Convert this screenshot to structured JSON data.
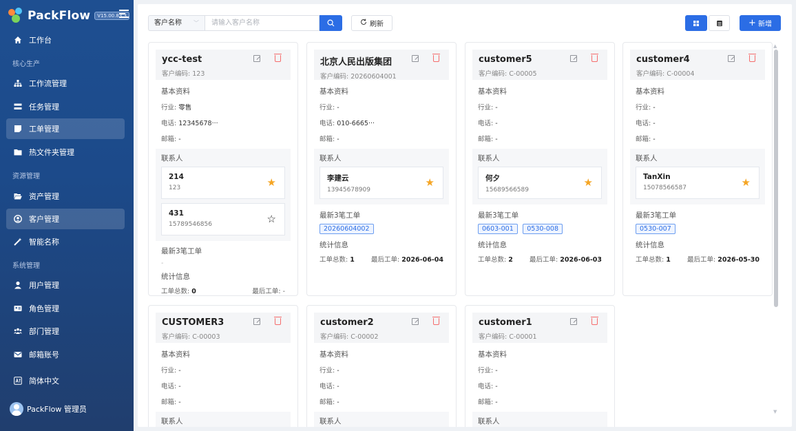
{
  "app": {
    "name": "PackFlow",
    "version": "V15.00.83.3"
  },
  "sidebar": {
    "items": [
      {
        "label": "工作台",
        "icon": "home-icon"
      },
      {
        "label": "工作流管理",
        "icon": "workflow-icon"
      },
      {
        "label": "任务管理",
        "icon": "task-icon"
      },
      {
        "label": "工单管理",
        "icon": "workorder-icon"
      },
      {
        "label": "热文件夹管理",
        "icon": "folder-icon"
      },
      {
        "label": "资产管理",
        "icon": "open-folder-icon"
      },
      {
        "label": "客户管理",
        "icon": "customer-icon"
      },
      {
        "label": "智能名称",
        "icon": "magic-wand-icon"
      },
      {
        "label": "用户管理",
        "icon": "user-icon"
      },
      {
        "label": "角色管理",
        "icon": "id-card-icon"
      },
      {
        "label": "部门管理",
        "icon": "team-icon"
      },
      {
        "label": "邮箱账号",
        "icon": "mail-icon"
      },
      {
        "label": "简体中文",
        "icon": "language-icon"
      }
    ],
    "sections": [
      "核心生产",
      "资源管理",
      "系统管理"
    ],
    "active_items": [
      "工单管理",
      "客户管理"
    ],
    "user": "PackFlow 管理员"
  },
  "toolbar": {
    "filter_field": "客户名称",
    "search_placeholder": "请输入客户名称",
    "refresh_label": "刷新",
    "add_label": "新增"
  },
  "labels": {
    "code_prefix": "客户编码: ",
    "basic": "基本资料",
    "industry": "行业: ",
    "phone": "电话: ",
    "email": "邮箱: ",
    "contacts": "联系人",
    "recent": "最新3笔工单",
    "stats": "统计信息",
    "total": "工单总数: ",
    "last": "最后工单: "
  },
  "customers": [
    {
      "name": "ycc-test",
      "code": "123",
      "industry": "零售",
      "phone": "12345678···",
      "email": "-",
      "contacts": [
        {
          "name": "214",
          "phone": "123",
          "starred": true
        },
        {
          "name": "431",
          "phone": "15789546856",
          "starred": false
        }
      ],
      "recent_orders": [],
      "recent_empty": "-",
      "total": "0",
      "last_order": "-"
    },
    {
      "name": "北京人民出版集团",
      "code": "20260604001",
      "industry": "-",
      "phone": "010-6665···",
      "email": "-",
      "contacts": [
        {
          "name": "李建云",
          "phone": "13945678909",
          "starred": true
        }
      ],
      "recent_orders": [
        "20260604002"
      ],
      "total": "1",
      "last_order": "2026-06-04"
    },
    {
      "name": "customer5",
      "code": "C-00005",
      "industry": "-",
      "phone": "-",
      "email": "-",
      "contacts": [
        {
          "name": "何夕",
          "phone": "15689566589",
          "starred": true
        }
      ],
      "recent_orders": [
        "0603-001",
        "0530-008"
      ],
      "total": "2",
      "last_order": "2026-06-03"
    },
    {
      "name": "customer4",
      "code": "C-00004",
      "industry": "-",
      "phone": "-",
      "email": "-",
      "contacts": [
        {
          "name": "TanXin",
          "phone": "15078566587",
          "starred": true
        }
      ],
      "recent_orders": [
        "0530-007"
      ],
      "total": "1",
      "last_order": "2026-05-30"
    },
    {
      "name": "CUSTOMER3",
      "code": "C-00003",
      "industry": "-",
      "phone": "-",
      "email": "-"
    },
    {
      "name": "customer2",
      "code": "C-00002",
      "industry": "-",
      "phone": "-",
      "email": "-"
    },
    {
      "name": "customer1",
      "code": "C-00001",
      "industry": "-",
      "phone": "-",
      "email": "-"
    }
  ],
  "colors": {
    "primary": "#2b6de5",
    "sidebar": "#1e4f91",
    "star": "#f5a524",
    "danger": "#f56c6c"
  }
}
